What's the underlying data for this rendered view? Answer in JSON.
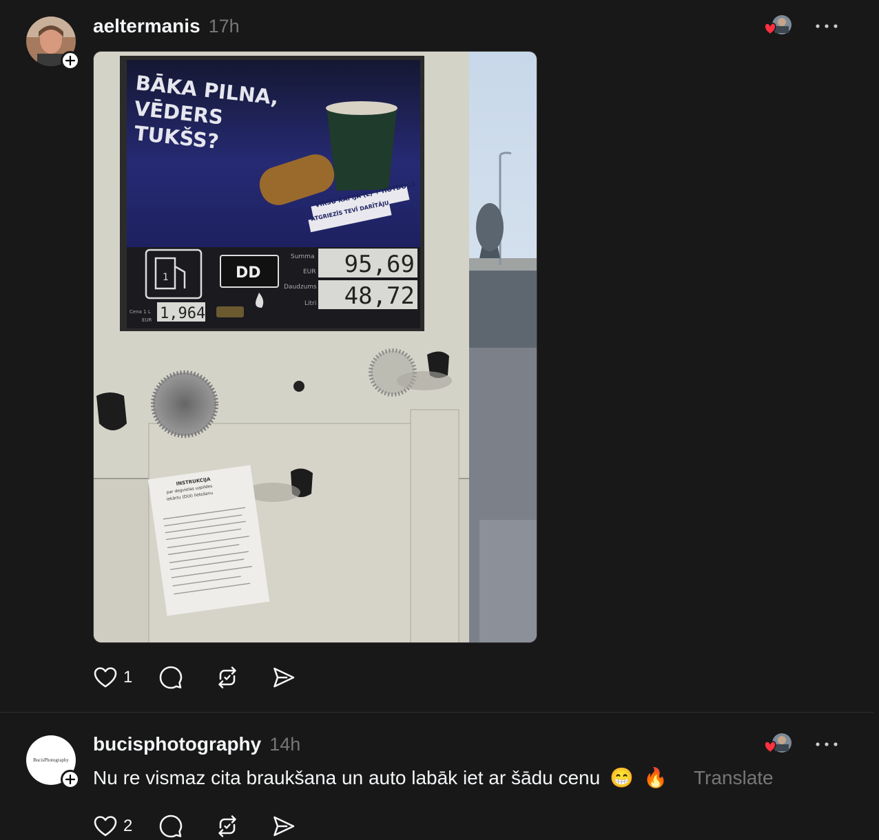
{
  "posts": [
    {
      "username": "aeltermanis",
      "time": "17h",
      "media": {
        "headline": [
          "BĀKA PILNA,",
          "VĒDERS",
          "TUKŠS?"
        ],
        "promo": [
          "VIRŠU KAFIJA (L) + HOTDOGS",
          "ATGRIEZĪS TEVĪ DARĪTĀJU"
        ],
        "fuel_type": "DD",
        "pump_number": "1",
        "labels": {
          "summa": "Summa",
          "eur": "EUR",
          "daudzums": "Daudzums",
          "litri": "Litri",
          "cena": "Cena 1 L",
          "cena_eur": "EUR"
        },
        "amount": "95,69",
        "liters": "48,72",
        "price": "1,964",
        "notice_title": [
          "INSTRUKCIJA",
          "par degvielas uzpildes",
          "iekārtu (DUI) lietošanu"
        ]
      },
      "likes": "1",
      "icons": [
        "heart-icon",
        "comment-icon",
        "repost-icon",
        "share-icon"
      ]
    },
    {
      "username": "bucisphotography",
      "time": "14h",
      "avatar_text": "BucisPhotography",
      "text": "Nu re vismaz cita braukšana un auto labāk iet ar šādu cenu",
      "emoji": [
        "😁",
        "🔥"
      ],
      "translate": "Translate",
      "likes": "2",
      "icons": [
        "heart-icon",
        "comment-icon",
        "repost-icon",
        "share-icon"
      ]
    }
  ],
  "colors": {
    "background": "#181818",
    "text": "#f3f5f7",
    "muted": "#777777",
    "heart": "#ff3040"
  }
}
